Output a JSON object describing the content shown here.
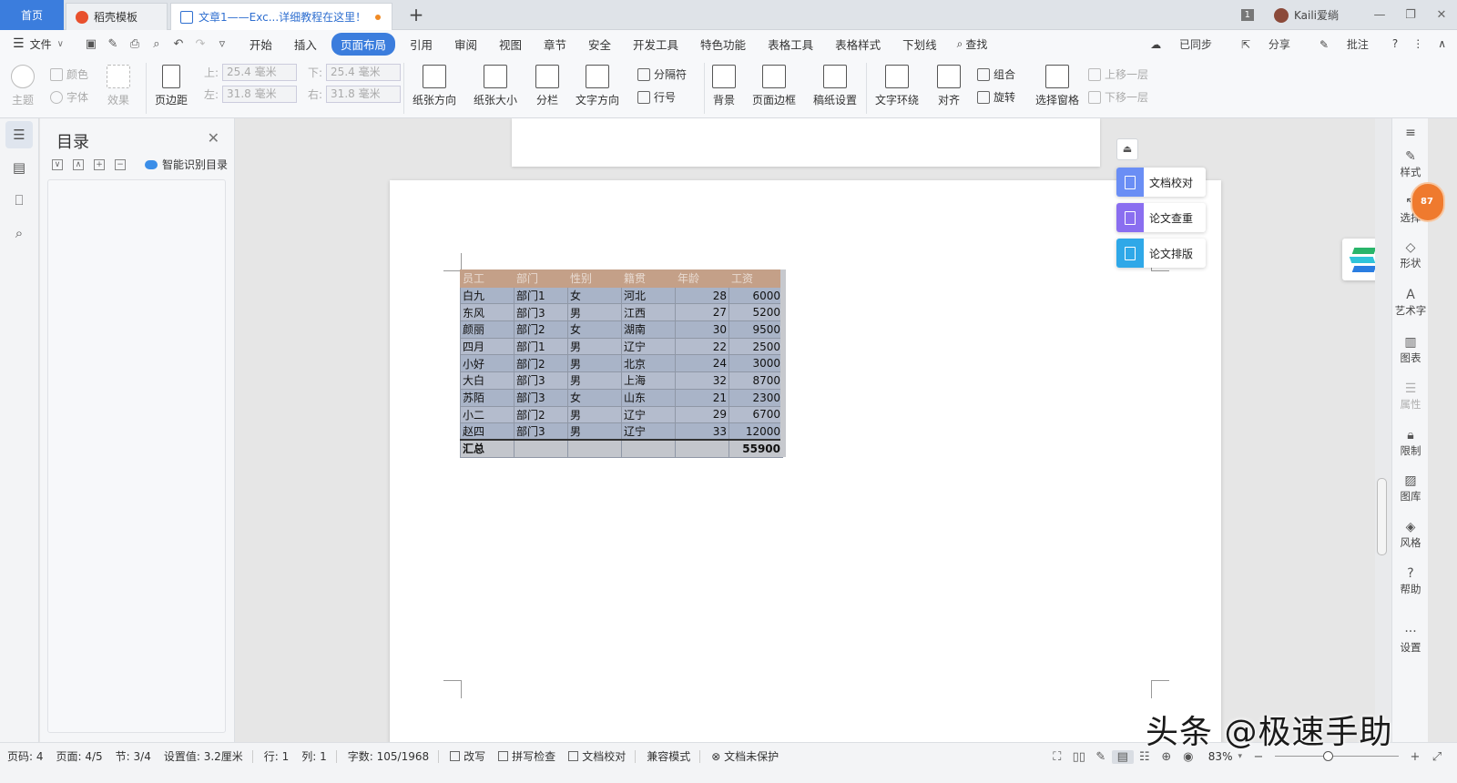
{
  "colors": {
    "accent": "#3b7ddd",
    "table_header": "#c4a088",
    "table_row": "#a9b4c8",
    "float_blue": "#6a8ef5",
    "float_purple": "#8a6ef0",
    "float_cyan": "#2fa8e8",
    "badge_orange": "#ef7a2e"
  },
  "tabs": {
    "home": "首页",
    "template": "稻壳模板",
    "doc": "文章1——Exc...详细教程在这里！",
    "new_tab": "+"
  },
  "window": {
    "badge": "1",
    "user": "Kaili爱绱",
    "minimize": "—",
    "restore": "❐",
    "close": "✕"
  },
  "menu": {
    "file": "文件",
    "items": [
      "开始",
      "插入",
      "页面布局",
      "引用",
      "审阅",
      "视图",
      "章节",
      "安全",
      "开发工具",
      "特色功能",
      "表格工具",
      "表格样式",
      "下划线"
    ],
    "active_index": 2,
    "search": "查找",
    "sync": "已同步",
    "share": "分享",
    "comment": "批注",
    "help": "?",
    "more": "⋮",
    "collapse": "∧"
  },
  "ribbon": {
    "theme": "主题",
    "colors": "颜色",
    "fonts": "字体",
    "effects": "效果",
    "margins": "页边距",
    "top_label": "上:",
    "top_value": "25.4 毫米",
    "bottom_label": "下:",
    "bottom_value": "25.4 毫米",
    "left_label": "左:",
    "left_value": "31.8 毫米",
    "right_label": "右:",
    "right_value": "31.8 毫米",
    "orientation": "纸张方向",
    "size": "纸张大小",
    "columns": "分栏",
    "text_direction": "文字方向",
    "breaks": "分隔符",
    "line_numbers": "行号",
    "background": "背景",
    "page_border": "页面边框",
    "draft_setup": "稿纸设置",
    "wrap_text": "文字环绕",
    "align": "对齐",
    "group": "组合",
    "rotate": "旋转",
    "selection_pane": "选择窗格",
    "bring_forward": "上移一层",
    "send_backward": "下移一层"
  },
  "toc": {
    "title": "目录",
    "smart": "智能识别目录"
  },
  "table": {
    "headers": [
      "员工",
      "部门",
      "性别",
      "籍贯",
      "年龄",
      "工资"
    ],
    "rows": [
      [
        "白九",
        "部门1",
        "女",
        "河北",
        "28",
        "6000"
      ],
      [
        "东风",
        "部门3",
        "男",
        "江西",
        "27",
        "5200"
      ],
      [
        "颜丽",
        "部门2",
        "女",
        "湖南",
        "30",
        "9500"
      ],
      [
        "四月",
        "部门1",
        "男",
        "辽宁",
        "22",
        "2500"
      ],
      [
        "小好",
        "部门2",
        "男",
        "北京",
        "24",
        "3000"
      ],
      [
        "大白",
        "部门3",
        "男",
        "上海",
        "32",
        "8700"
      ],
      [
        "苏陌",
        "部门3",
        "女",
        "山东",
        "21",
        "2300"
      ],
      [
        "小二",
        "部门2",
        "男",
        "辽宁",
        "29",
        "6700"
      ],
      [
        "赵四",
        "部门3",
        "男",
        "辽宁",
        "33",
        "12000"
      ]
    ],
    "total_label": "汇总",
    "total_value": "55900"
  },
  "float_tools": {
    "proofread": "文档校对",
    "plagiarism": "论文查重",
    "format": "论文排版"
  },
  "right_panel": {
    "style": "样式",
    "select": "选择",
    "shape": "形状",
    "wordart": "艺术字",
    "chart": "图表",
    "properties": "属性",
    "restrict": "限制",
    "gallery": "图库",
    "theme_style": "风格",
    "help": "帮助",
    "settings": "设置",
    "badge_text": "87"
  },
  "status": {
    "page_code": "页码: 4",
    "page": "页面: 4/5",
    "section": "节: 3/4",
    "setting": "设置值: 3.2厘米",
    "row": "行: 1",
    "col": "列: 1",
    "words": "字数: 105/1968",
    "revise": "改写",
    "spell": "拼写检查",
    "proof": "文档校对",
    "compat": "兼容模式",
    "protect": "文档未保护",
    "zoom": "83%",
    "zoom_fraction": 0.42
  },
  "watermark": "头条 @极速手助"
}
